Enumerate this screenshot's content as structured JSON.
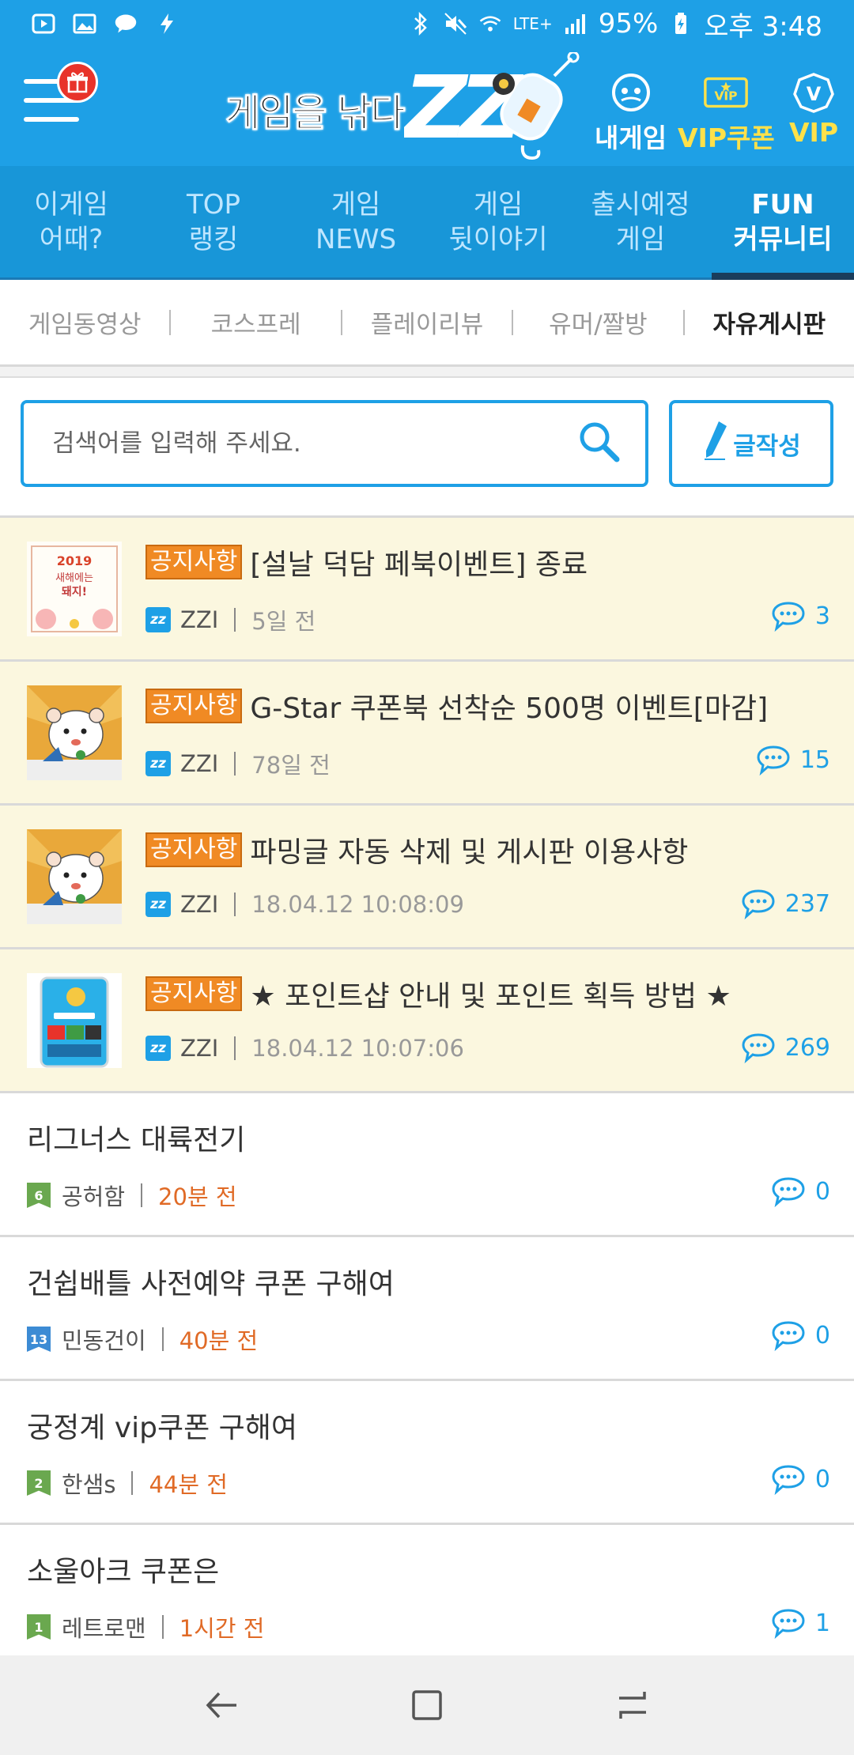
{
  "status_bar": {
    "battery": "95%",
    "time": "오후 3:48",
    "network": "LTE+"
  },
  "header": {
    "logo_text": "게임을 낚다",
    "logo_brand": "ZZI",
    "buttons": [
      {
        "label": "내게임",
        "icon": "controller-icon",
        "color": "#ffffff"
      },
      {
        "label": "VIP쿠폰",
        "icon": "vip-coupon-icon",
        "color": "#ffe14a"
      },
      {
        "label": "VIP",
        "icon": "vip-badge-icon",
        "color": "#ffe14a"
      }
    ]
  },
  "tabs": [
    {
      "line1": "이게임",
      "line2": "어때?"
    },
    {
      "line1": "TOP",
      "line2": "랭킹"
    },
    {
      "line1": "게임",
      "line2": "NEWS"
    },
    {
      "line1": "게임",
      "line2": "뒷이야기"
    },
    {
      "line1": "출시예정",
      "line2": "게임"
    },
    {
      "line1": "FUN",
      "line2": "커뮤니티"
    }
  ],
  "subtabs": [
    "게임동영상",
    "코스프레",
    "플레이리뷰",
    "유머/짤방",
    "자유게시판"
  ],
  "search": {
    "placeholder": "검색어를 입력해 주세요.",
    "write_label": "글작성"
  },
  "notice_tag": "공지사항",
  "posts": [
    {
      "title": "[설날 덕담 페북이벤트] 종료",
      "author": "ZZI",
      "time": "5일 전",
      "comments": "3",
      "thumb": "newyear"
    },
    {
      "title": "G-Star 쿠폰북 선착순 500명 이벤트[마감]",
      "author": "ZZI",
      "time": "78일 전",
      "comments": "15",
      "thumb": "hamster"
    },
    {
      "title": "파밍글 자동 삭제 및 게시판 이용사항",
      "author": "ZZI",
      "time": "18.04.12 10:08:09",
      "comments": "237",
      "thumb": "hamster"
    },
    {
      "title": "★ 포인트샵 안내 및 포인트 획득 방법 ★",
      "author": "ZZI",
      "time": "18.04.12 10:07:06",
      "comments": "269",
      "thumb": "phone"
    },
    {
      "title": "리그너스 대륙전기",
      "author": "공허함",
      "level": "6",
      "level_color": "green",
      "time": "20분 전",
      "comments": "0"
    },
    {
      "title": "건쉽배틀 사전예약 쿠폰 구해여",
      "author": "민동건이",
      "level": "13",
      "level_color": "blue",
      "time": "40분 전",
      "comments": "0"
    },
    {
      "title": "궁정계 vip쿠폰 구해여",
      "author": "한샘s",
      "level": "2",
      "level_color": "green",
      "time": "44분 전",
      "comments": "0"
    },
    {
      "title": "소울아크 쿠폰은",
      "author": "레트로맨",
      "level": "1",
      "level_color": "green",
      "time": "1시간 전",
      "comments": "1"
    }
  ],
  "thumb_text": {
    "year": "2019",
    "newyear_line1": "새해에는",
    "newyear_line2": "돼지!"
  }
}
